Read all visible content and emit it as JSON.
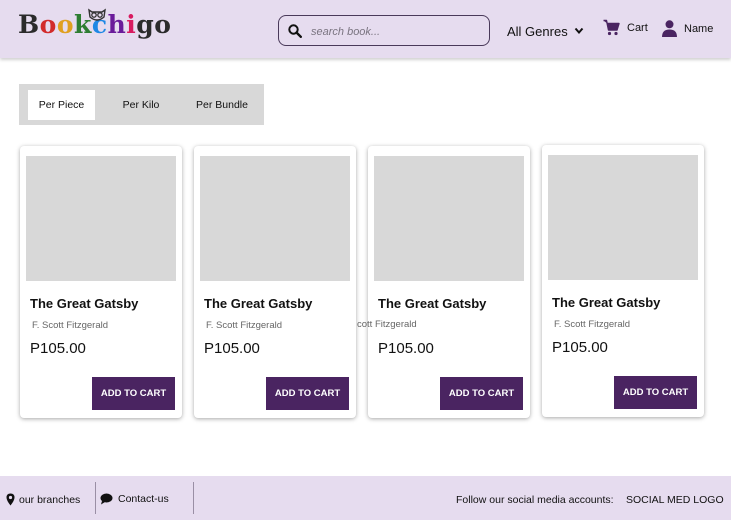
{
  "header": {
    "logo_letters": [
      "B",
      "o",
      "o",
      "k",
      "c",
      "h",
      "i",
      "g",
      "o"
    ],
    "logo_colors": [
      "#2b2b2b",
      "#d22b2b",
      "#e0a020",
      "#2e7d32",
      "#1e88e5",
      "#6a1b9a",
      "#d81b60",
      "#2b2b2b",
      "#2b2b2b"
    ],
    "search_placeholder": "search book...",
    "genres_label": "All Genres",
    "cart_label": "Cart",
    "user_label": "Name"
  },
  "tabs": [
    {
      "label": "Per Piece",
      "active": true
    },
    {
      "label": "Per Kilo",
      "active": false
    },
    {
      "label": "Per Bundle",
      "active": false
    }
  ],
  "products": [
    {
      "title": "The Great Gatsby",
      "author": "F. Scott Fitzgerald",
      "price": "P105.00",
      "button": "ADD TO CART"
    },
    {
      "title": "The Great Gatsby",
      "author": "F. Scott Fitzgerald",
      "price": "P105.00",
      "button": "ADD TO CART"
    },
    {
      "title": "The Great Gatsby",
      "author": "",
      "price": "P105.00",
      "button": "ADD TO CART"
    },
    {
      "title": "The Great Gatsby",
      "author": "F. Scott Fitzgerald",
      "price": "P105.00",
      "button": "ADD TO CART"
    }
  ],
  "stray_author_text": "cott Fitzgerald",
  "footer": {
    "branches_label": "our branches",
    "contact_label": "Contact-us",
    "social_text": "Follow our social media accounts:",
    "social_logo_text": "SOCIAL MED LOGO"
  },
  "colors": {
    "header_bg": "#e6dcef",
    "accent": "#4a2461",
    "placeholder_gray": "#d8d8d8"
  }
}
